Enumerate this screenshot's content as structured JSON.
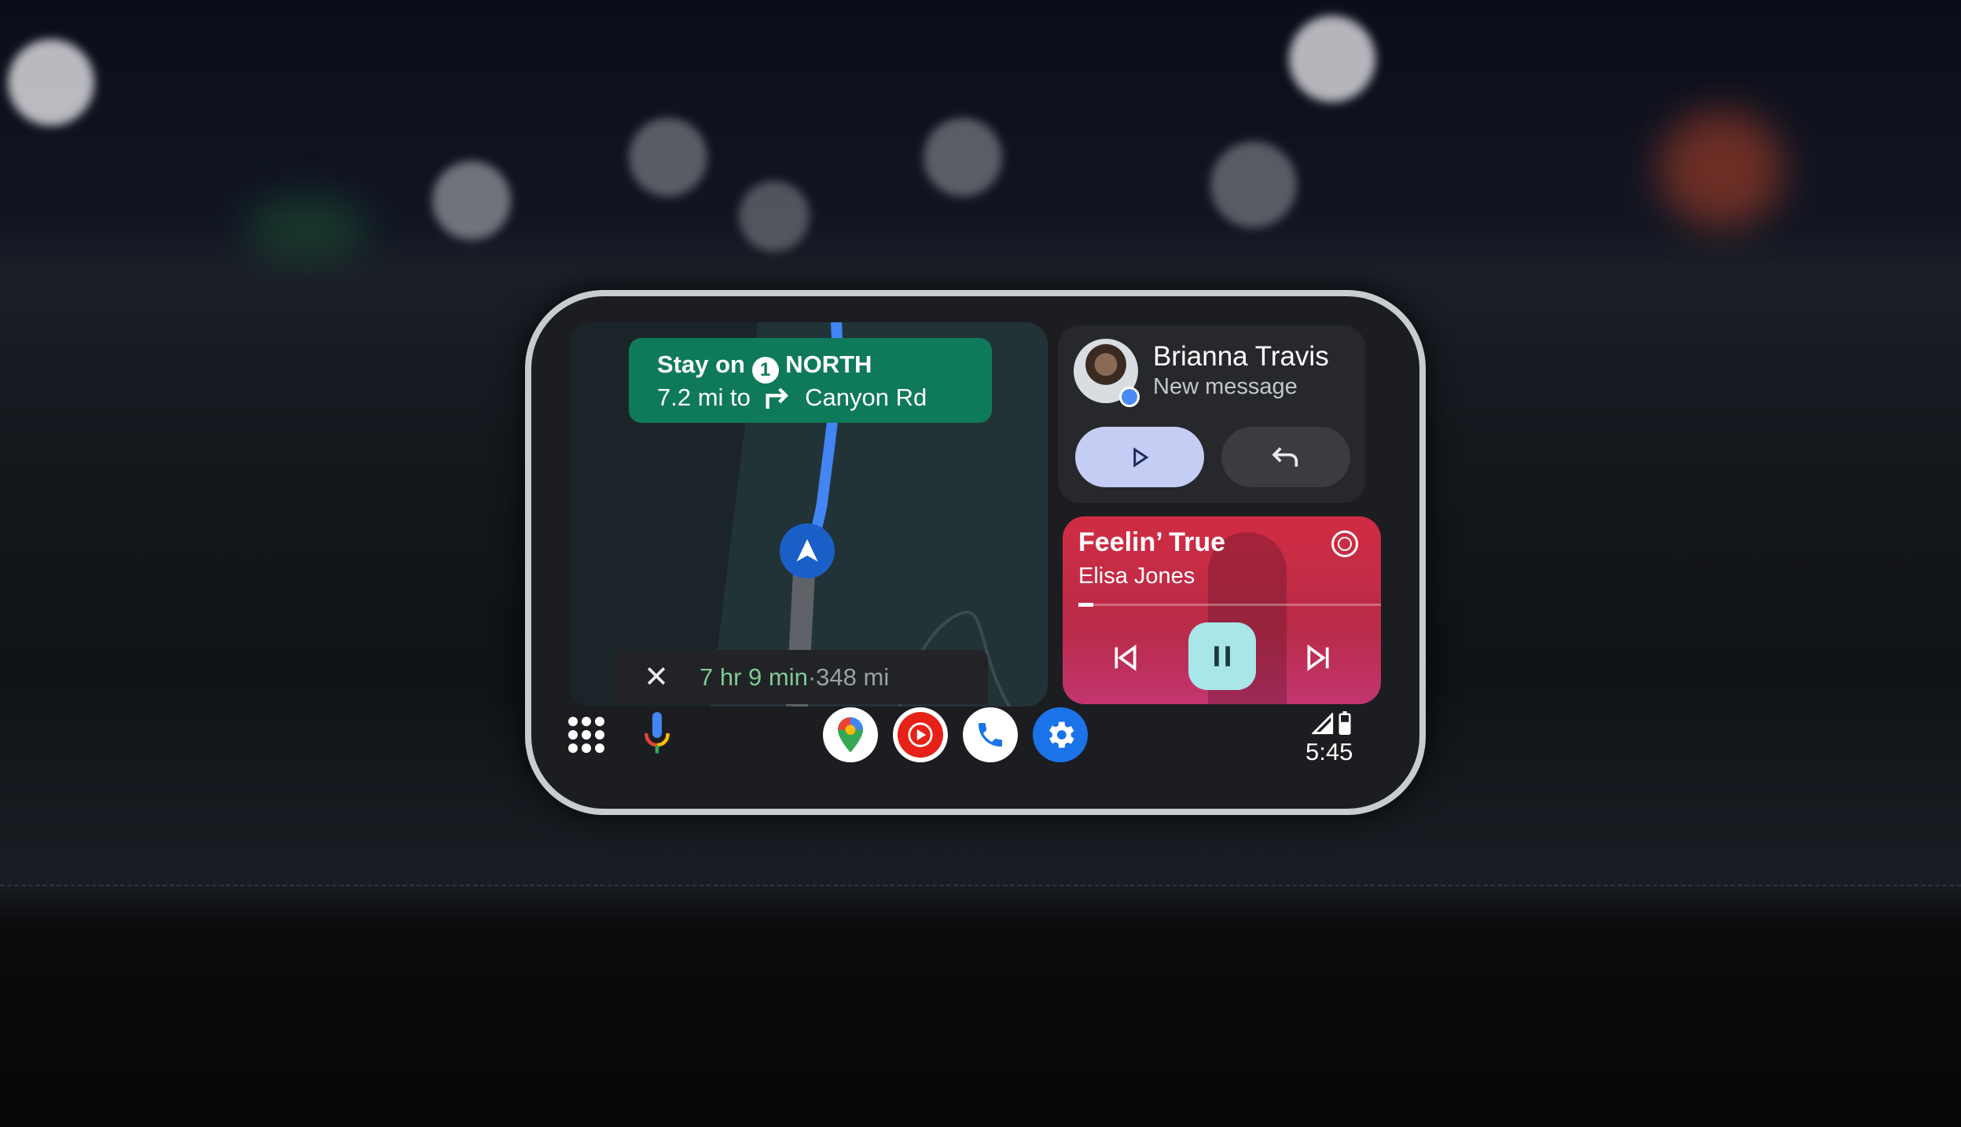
{
  "navigation": {
    "instruction_prefix": "Stay on",
    "route_number": "1",
    "direction": "NORTH",
    "distance": "7.2 mi to",
    "street": "Canyon Rd",
    "eta_time": "7 hr 9 min",
    "eta_separator": " · ",
    "eta_distance": "348 mi"
  },
  "message": {
    "contact_name": "Brianna Travis",
    "subtitle": "New message"
  },
  "media": {
    "track_title": "Feelin’ True",
    "artist": "Elisa Jones",
    "progress_percent": 5
  },
  "dock": {
    "apps": [
      {
        "name": "Google Maps",
        "icon": "maps-pin-icon"
      },
      {
        "name": "YouTube Music",
        "icon": "youtube-music-icon"
      },
      {
        "name": "Phone",
        "icon": "phone-icon"
      },
      {
        "name": "Settings",
        "icon": "gear-icon"
      }
    ]
  },
  "status": {
    "time": "5:45"
  },
  "colors": {
    "nav_green": "#0f7a5a",
    "route_blue": "#4285f4",
    "media_red": "#d02c43",
    "pause_cyan": "#a8e6ea",
    "play_lavender": "#c5cdf5",
    "eta_green": "#81c995"
  }
}
